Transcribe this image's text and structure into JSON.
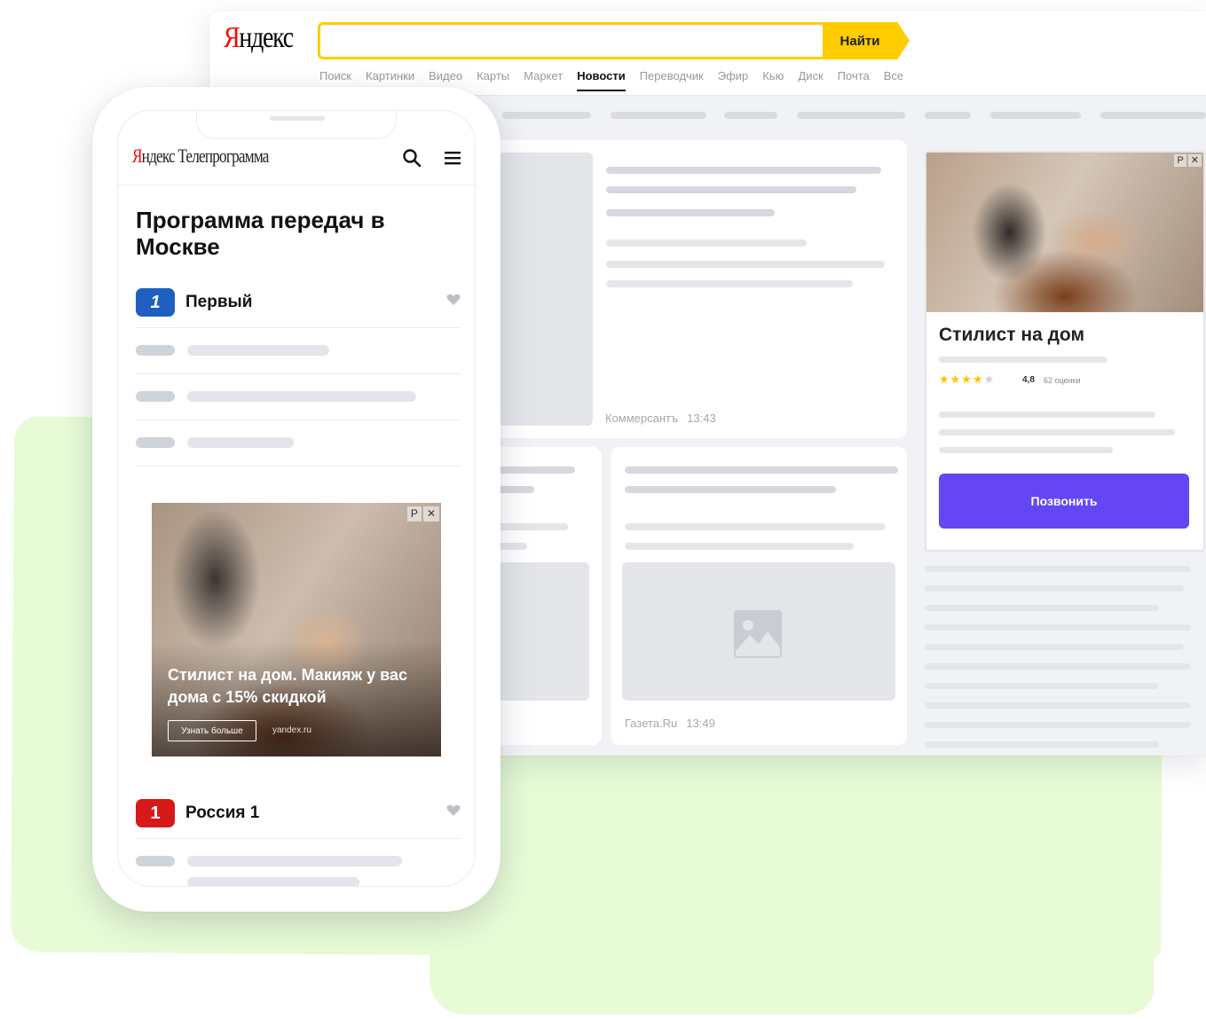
{
  "desktop": {
    "logo": {
      "ya": "Я",
      "rest": "ндекс"
    },
    "search": {
      "placeholder": "",
      "button_label": "Найти"
    },
    "tabs": [
      "Поиск",
      "Картинки",
      "Видео",
      "Карты",
      "Маркет",
      "Новости",
      "Переводчик",
      "Эфир",
      "Кью",
      "Диск",
      "Почта",
      "Все"
    ],
    "active_tab": "Новости",
    "news": [
      {
        "source": "Коммерсантъ",
        "time": "13:43"
      },
      {
        "source": "Газета.Ru",
        "time": "13:49"
      }
    ],
    "ad": {
      "badge_label": "Р",
      "close_icon": "close-icon",
      "title": "Стилист на дом",
      "stars_filled": 4,
      "stars_total": 5,
      "rating": "4,8",
      "rating_count": "62 оценки",
      "button_label": "Позвонить",
      "button_color": "#6446f2"
    }
  },
  "phone": {
    "logo": {
      "ya": "Я",
      "rest": "ндекс Телепрограмма"
    },
    "search_icon": "search-icon",
    "menu_icon": "hamburger-menu-icon",
    "page_title": "Программа передач в Москве",
    "channels": [
      {
        "name": "Первый",
        "logo_text": "1",
        "color": "#1f5fbf"
      },
      {
        "name": "Россия 1",
        "logo_text": "1",
        "color": "#d81919"
      }
    ],
    "ad": {
      "badge_label": "Р",
      "text": "Стилист на дом. Макияж у вас дома с 15% скидкой",
      "button_label": "Узнать больше",
      "domain": "yandex.ru"
    }
  },
  "colors": {
    "accent_yellow": "#ffcc00",
    "background_green": "#e7fbd6",
    "placeholder_gray": "#d6d8de"
  }
}
